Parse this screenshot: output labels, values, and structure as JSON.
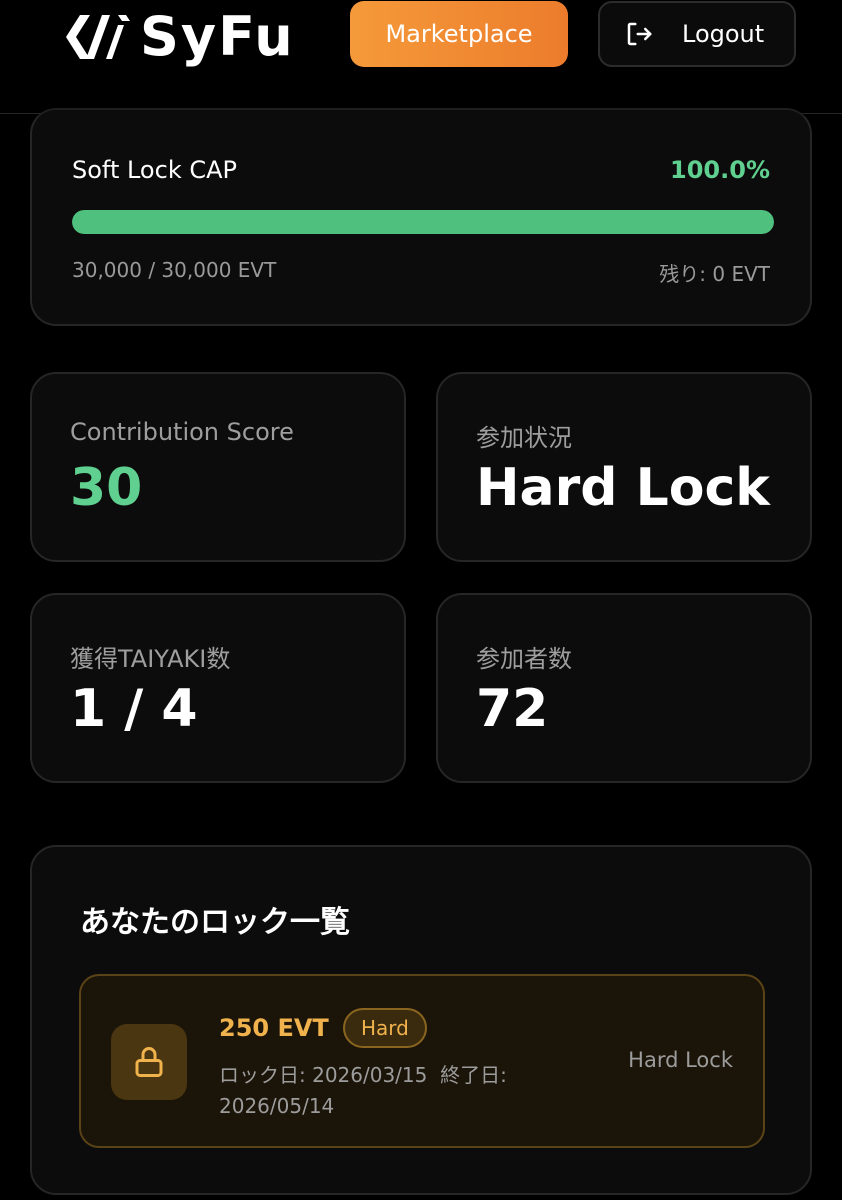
{
  "header": {
    "logo_text": "SyFu",
    "marketplace_label": "Marketplace",
    "logout_label": "Logout"
  },
  "soft_lock_cap": {
    "title": "Soft Lock CAP",
    "percent_label": "100.0%",
    "progress": 1.0,
    "amount": "30,000 / 30,000 EVT",
    "remaining": "残り: 0 EVT"
  },
  "stats": [
    {
      "label": "Contribution Score",
      "value": "30"
    },
    {
      "label": "参加状況",
      "value": "Hard Lock"
    },
    {
      "label": "獲得TAIYAKI数",
      "value": "1 / 4"
    },
    {
      "label": "参加者数",
      "value": "72"
    }
  ],
  "locks": {
    "title": "あなたのロック一覧",
    "items": [
      {
        "amount": "250 EVT",
        "badge": "Hard",
        "lock_date": "ロック日: 2026/03/15",
        "end_date": "終了日: 2026/05/14",
        "type": "Hard Lock"
      }
    ]
  },
  "colors": {
    "accent_orange": "#ec7c2c",
    "green": "#5fd08f",
    "gold": "#f0b24c"
  },
  "icons": [
    "logo-mark-icon",
    "logout-icon",
    "lock-icon"
  ]
}
